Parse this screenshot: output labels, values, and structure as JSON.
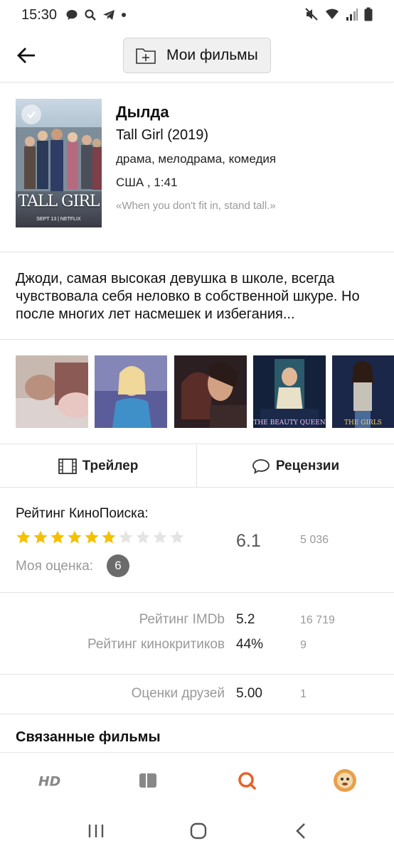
{
  "status_bar": {
    "time": "15:30",
    "left_icons": [
      "chat-bubble-icon",
      "search-icon",
      "telegram-icon",
      "dot-icon"
    ],
    "right_icons": [
      "mute-icon",
      "wifi-icon",
      "signal-icon",
      "battery-icon"
    ]
  },
  "header": {
    "back_icon": "arrow-left-icon",
    "my_films_label": "Мои фильмы",
    "my_films_icon": "folder-plus-icon"
  },
  "movie": {
    "title_ru": "Дылда",
    "title_en": "Tall Girl (2019)",
    "genres": "драма, мелодрама, комедия",
    "country_duration": "США , 1:41",
    "tagline": "«When you don't fit in, stand tall.»",
    "poster": {
      "title": "TALL GIRL",
      "subtitle": "SEPT 13 | NETFLIX"
    },
    "description": "Джоди, самая высокая девушка в школе, всегда чувствовала себя неловко в собственной шкуре. Но после многих лет насмешек и избегания..."
  },
  "stills": [
    {
      "name": "still-1"
    },
    {
      "name": "still-2"
    },
    {
      "name": "still-3"
    },
    {
      "name": "still-4",
      "caption": "THE BEAUTY QUEEN"
    },
    {
      "name": "still-5",
      "caption": "THE GIRLS"
    }
  ],
  "actions": {
    "trailer_label": "Трейлер",
    "trailer_icon": "film-icon",
    "reviews_label": "Рецензии",
    "reviews_icon": "speech-bubble-icon"
  },
  "kinopoisk": {
    "label": "Рейтинг КиноПоиска:",
    "stars_filled": 6,
    "stars_total": 10,
    "value": "6.1",
    "votes": "5 036",
    "my_rating_label": "Моя оценка:",
    "my_rating_value": "6"
  },
  "external_ratings": [
    {
      "label": "Рейтинг IMDb",
      "value": "5.2",
      "votes": "16 719"
    },
    {
      "label": "Рейтинг кинокритиков",
      "value": "44%",
      "votes": "9"
    }
  ],
  "friends": {
    "label": "Оценки друзей",
    "value": "5.00",
    "votes": "1"
  },
  "related": {
    "title": "Связанные фильмы"
  },
  "bottom_nav": {
    "items": [
      "hd-icon",
      "bookmark-icon",
      "search-icon",
      "avatar"
    ],
    "active": "search-icon",
    "accent": "#e8622a"
  },
  "system_nav": [
    "recents-icon",
    "home-icon",
    "back-icon"
  ]
}
